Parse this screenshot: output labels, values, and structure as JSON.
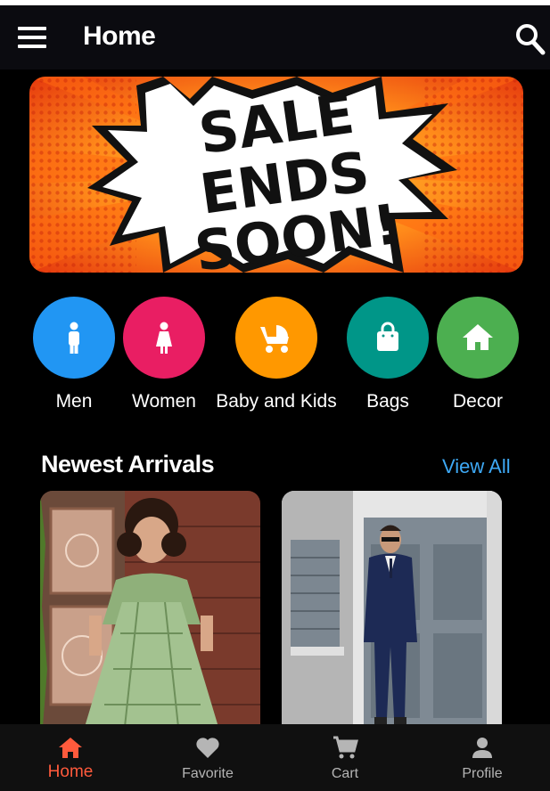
{
  "appbar": {
    "title": "Home",
    "menu_icon": "hamburger-menu-icon",
    "search_icon": "search-icon"
  },
  "banner": {
    "line1": "SALE",
    "line2": "ENDS",
    "line3": "SOON!"
  },
  "categories": [
    {
      "label": "Men",
      "icon": "man-icon",
      "color": "#2196f3"
    },
    {
      "label": "Women",
      "icon": "woman-icon",
      "color": "#e91e63"
    },
    {
      "label": "Baby and Kids",
      "icon": "stroller-icon",
      "color": "#ff9800"
    },
    {
      "label": "Bags",
      "icon": "shopping-bag-icon",
      "color": "#009688"
    },
    {
      "label": "Decor",
      "icon": "home-icon",
      "color": "#4caf50"
    }
  ],
  "newest": {
    "title": "Newest Arrivals",
    "view_all": "View All"
  },
  "bottom_nav": [
    {
      "label": "Home",
      "icon": "home-icon",
      "active": true,
      "color": "#ff5a3c"
    },
    {
      "label": "Favorite",
      "icon": "heart-icon",
      "active": false
    },
    {
      "label": "Cart",
      "icon": "cart-icon",
      "active": false
    },
    {
      "label": "Profile",
      "icon": "person-icon",
      "active": false
    }
  ]
}
